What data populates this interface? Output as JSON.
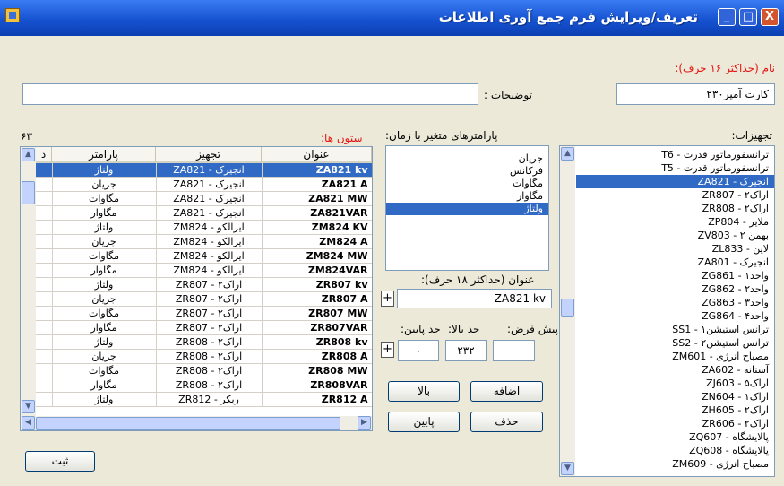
{
  "window": {
    "title": "تعریف/ویرایش فرم جمع آوری اطلاعات",
    "close_label": "X",
    "maximize_label": "□",
    "minimize_label": "_"
  },
  "form": {
    "name_label": "نام (حداکثر ۱۶ حرف):",
    "name_value": "کارت آمپر۲۳۰",
    "description_label": "توضیحات :",
    "description_value": ""
  },
  "equipment": {
    "label": "تجهیزات:",
    "items": [
      "ترانسفورماتور قدرت - T6",
      "ترانسفورماتور قدرت - T5",
      "انجیرک - ZA821",
      "اراک۲ - ZR807",
      "اراک۲ - ZR808",
      "ملایر - ZP804",
      "بهمن ۲ - ZV803",
      "لاین - ZL833",
      "انجیرک - ZA801",
      "واحد۱ - ZG861",
      "واحد۲ - ZG862",
      "واحد۳ - ZG863",
      "واحد۴ - ZG864",
      "ترانس استیشن۱ - SS1",
      "ترانس استیشن۲ - SS2",
      "مصباح انرژی - ZM601",
      "آستانه - ZA602",
      "اراک۵ - ZJ603",
      "اراک۱ - ZN604",
      "اراک۲ - ZH605",
      "اراک۲ - ZR606",
      "پالایشگاه - ZQ607",
      "پالایشگاه - ZQ608",
      "مصباح انرژی - ZM609"
    ],
    "selected_index": 2
  },
  "parameters": {
    "label": "پارامترهای متغیر با زمان:",
    "items": [
      "جریان",
      "فرکانس",
      "مگاوات",
      "مگاوار",
      "ولتاژ"
    ],
    "selected_index": 4
  },
  "title_field": {
    "label": "عنوان (حداکثر ۱۸ حرف):",
    "value": "ZA821 kv"
  },
  "limits": {
    "default_label": "پیش فرض:",
    "upper_label": "حد بالا:",
    "lower_label": "حد پایین:",
    "default_value": "",
    "upper_value": "۲۳۲",
    "lower_value": "۰"
  },
  "buttons": {
    "add": "اضافه",
    "up": "بالا",
    "delete": "حذف",
    "down": "پایین",
    "submit": "ثبت",
    "plus": "+"
  },
  "columns": {
    "label": "ستون ها:",
    "count": "۶۳",
    "headers": [
      "عنوان",
      "تجهیز",
      "پارامتر",
      "د"
    ],
    "rows": [
      [
        "ZA821 kv",
        "انجیرک - ZA821",
        "ولتاژ"
      ],
      [
        "ZA821 A",
        "انجیرک - ZA821",
        "جریان"
      ],
      [
        "ZA821 MW",
        "انجیرک - ZA821",
        "مگاوات"
      ],
      [
        "ZA821VAR",
        "انجیرک - ZA821",
        "مگاوار"
      ],
      [
        "ZM824 KV",
        "ایرالکو - ZM824",
        "ولتاژ"
      ],
      [
        "ZM824 A",
        "ایرالکو - ZM824",
        "جریان"
      ],
      [
        "ZM824 MW",
        "ایرالکو - ZM824",
        "مگاوات"
      ],
      [
        "ZM824VAR",
        "ایرالکو - ZM824",
        "مگاوار"
      ],
      [
        "ZR807 kv",
        "اراک۲ - ZR807",
        "ولتاژ"
      ],
      [
        "ZR807 A",
        "اراک۲ - ZR807",
        "جریان"
      ],
      [
        "ZR807 MW",
        "اراک۲ - ZR807",
        "مگاوات"
      ],
      [
        "ZR807VAR",
        "اراک۲ - ZR807",
        "مگاوار"
      ],
      [
        "ZR808 kv",
        "اراک۲ - ZR808",
        "ولتاژ"
      ],
      [
        "ZR808 A",
        "اراک۲ - ZR808",
        "جریان"
      ],
      [
        "ZR808 MW",
        "اراک۲ - ZR808",
        "مگاوات"
      ],
      [
        "ZR808VAR",
        "اراک۲ - ZR808",
        "مگاوار"
      ],
      [
        "ZR812 A",
        "ربکر - ZR812",
        "ولتاژ"
      ]
    ],
    "selected_index": 0
  }
}
